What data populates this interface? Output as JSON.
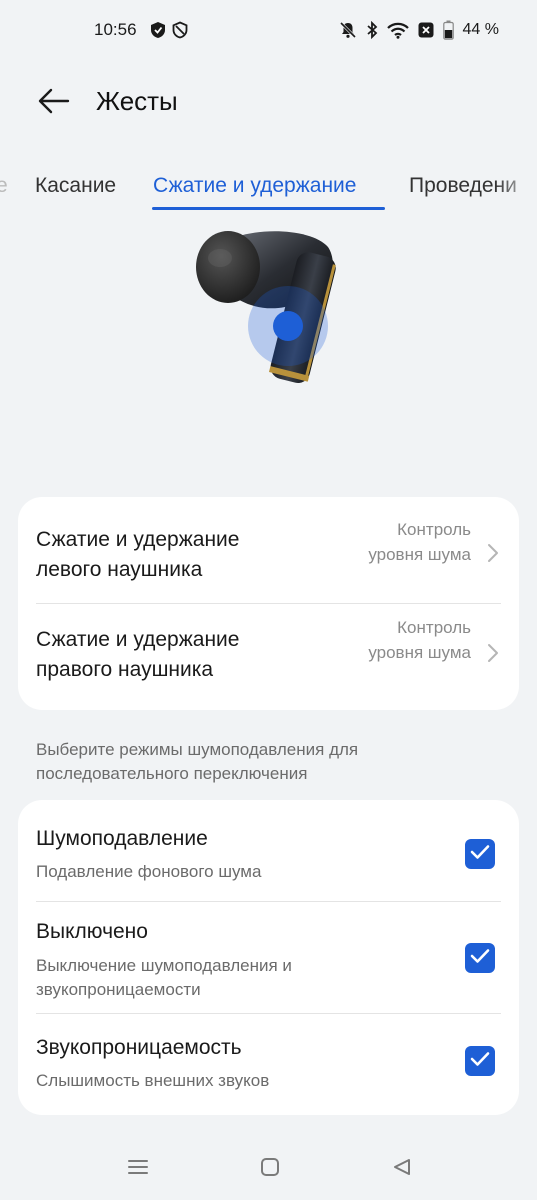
{
  "status_bar": {
    "time": "10:56",
    "battery_percent": "44 %",
    "left_icons": [
      "shield-icon",
      "shield-outline-icon"
    ],
    "right_icons": [
      "mute-bell-icon",
      "bluetooth-icon",
      "wifi-icon",
      "battery-saver-icon",
      "battery-icon"
    ]
  },
  "header": {
    "back_icon": "arrow-left-icon",
    "title": "Жесты"
  },
  "tabs": {
    "items": [
      {
        "label": "е",
        "active": false
      },
      {
        "label": "Касание",
        "active": false
      },
      {
        "label": "Сжатие и удержание",
        "active": true
      },
      {
        "label": "Проведени",
        "active": false
      }
    ]
  },
  "gestures": {
    "rows": [
      {
        "title": "Сжатие и удержание левого наушника",
        "value": "Контроль уровня шума"
      },
      {
        "title": "Сжатие и удержание правого наушника",
        "value": "Контроль уровня шума"
      }
    ]
  },
  "hint": "Выберите режимы шумоподавления для последовательного переключения",
  "modes": {
    "rows": [
      {
        "title": "Шумоподавление",
        "subtitle": "Подавление фонового шума",
        "checked": true
      },
      {
        "title": "Выключено",
        "subtitle": "Выключение шумоподавления и звукопроницаемости",
        "checked": true
      },
      {
        "title": "Звукопроницаемость",
        "subtitle": "Слышимость внешних звуков",
        "checked": true
      }
    ]
  },
  "navbar": {
    "items": [
      "menu-icon",
      "home-square-icon",
      "back-triangle-icon"
    ]
  },
  "colors": {
    "accent": "#1e5fd6",
    "background": "#f1f3f5",
    "card": "#ffffff"
  }
}
